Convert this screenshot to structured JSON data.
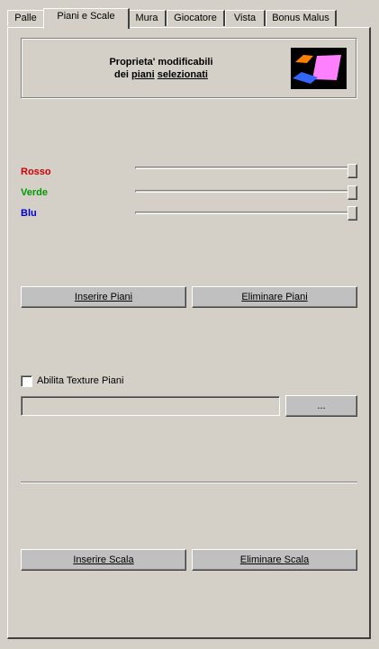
{
  "tabs": [
    {
      "label": "Palle",
      "active": false
    },
    {
      "label": "Piani e Scale",
      "active": true
    },
    {
      "label": "Mura",
      "active": false
    },
    {
      "label": "Giocatore",
      "active": false
    },
    {
      "label": "Vista",
      "active": false
    },
    {
      "label": "Bonus Malus",
      "active": false
    }
  ],
  "properties_box": {
    "line1": "Proprieta' modificabili",
    "line2_prefix": "dei ",
    "line2_word1": "piani",
    "line2_word2": "selezionati"
  },
  "sliders": [
    {
      "label": "Rosso",
      "color": "#cc0000",
      "value_fraction": 1.0
    },
    {
      "label": "Verde",
      "color": "#009900",
      "value_fraction": 1.0
    },
    {
      "label": "Blu",
      "color": "#0000cc",
      "value_fraction": 1.0
    }
  ],
  "buttons": {
    "insert_planes": "Inserire Piani",
    "delete_planes": "Eliminare Piani",
    "browse": "...",
    "insert_stair": "Inserire Scala",
    "delete_stair": "Eliminare Scala"
  },
  "texture": {
    "checkbox_label": "Abilita Texture Piani",
    "checked": false,
    "path_value": ""
  },
  "colors": {
    "background": "#d4d0c8",
    "button_face": "#c0c0c0",
    "logo_bg": "#000000",
    "logo_pink": "#ff80ff",
    "logo_orange": "#ff8000",
    "logo_blue": "#3366ff"
  }
}
